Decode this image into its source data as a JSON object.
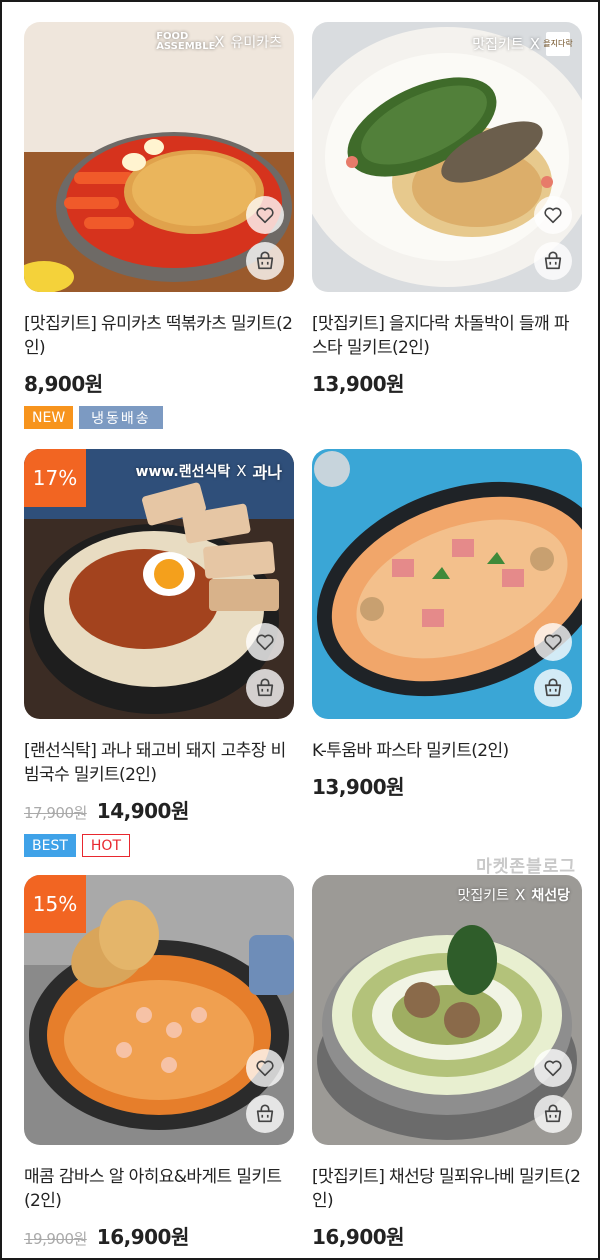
{
  "watermark": "마켓존블로그",
  "colors": {
    "discount_badge": "#f26522",
    "new_badge": "#f7941d",
    "frozen_badge": "#7c9ac2",
    "best_badge": "#3fa2e8",
    "hot_badge": "#e8282f"
  },
  "products": [
    {
      "title": "[맛집키트] 유미카츠 떡볶카츠 밀키트(2인)",
      "price": "8,900원",
      "brand": {
        "left": "FOOD ASSEMBLE",
        "sep": "X",
        "right": "유미카츠"
      },
      "wishlist_icon": "heart-icon",
      "cart_icon": "shopping-bag-icon"
    },
    {
      "title": "[맛집키트] 을지다락 차돌박이 들깨 파스타 밀키트(2인)",
      "price": "13,900원",
      "brand": {
        "left": "맛집키트",
        "sep": "X",
        "right": "을지다락"
      },
      "wishlist_icon": "heart-icon",
      "cart_icon": "shopping-bag-icon"
    },
    {
      "title": "[랜선식탁] 과나 돼고비 돼지 고추장 비빔국수 밀키트(2인)",
      "original_price": "17,900원",
      "price": "14,900원",
      "discount": "17%",
      "brand": {
        "left": "www.랜선식탁",
        "sep": "X",
        "right": "과나"
      },
      "wishlist_icon": "heart-icon",
      "cart_icon": "shopping-bag-icon"
    },
    {
      "title": "K-투움바 파스타 밀키트(2인)",
      "price": "13,900원",
      "wishlist_icon": "heart-icon",
      "cart_icon": "shopping-bag-icon"
    },
    {
      "title": "매콤 감바스 알 아히요&바게트 밀키트(2인)",
      "original_price": "19,900원",
      "price": "16,900원",
      "discount": "15%",
      "wishlist_icon": "heart-icon",
      "cart_icon": "shopping-bag-icon"
    },
    {
      "title": "[맛집키트] 채선당 밀푀유나베 밀키트(2인)",
      "price": "16,900원",
      "brand": {
        "left": "맛집키트",
        "sep": "X",
        "right": "채선당"
      },
      "wishlist_icon": "heart-icon",
      "cart_icon": "shopping-bag-icon"
    }
  ],
  "badge_rows": [
    [
      {
        "label": "NEW"
      },
      {
        "label": "냉동배송"
      }
    ],
    [
      {
        "label": "BEST"
      },
      {
        "label": "HOT"
      }
    ]
  ]
}
